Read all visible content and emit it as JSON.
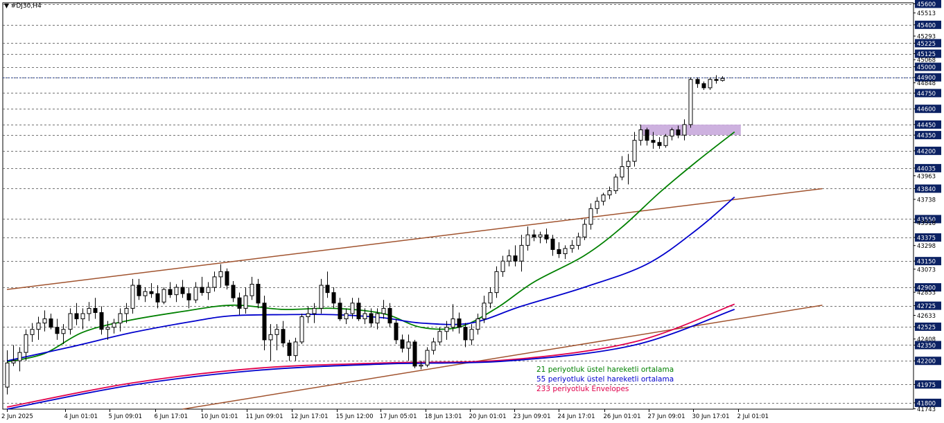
{
  "chart_data": {
    "type": "candlestick",
    "symbol_label": "#DJ30,H4",
    "title_marker": "▼",
    "ylim": [
      41740,
      45610
    ],
    "y_tick_labels": [
      45600,
      45513,
      45400,
      45293,
      45225,
      45125,
      45068,
      45000,
      44900,
      44848,
      44750,
      44600,
      44450,
      44350,
      44200,
      44035,
      43963,
      43840,
      43738,
      43550,
      43518,
      43375,
      43298,
      43150,
      43073,
      42900,
      42853,
      42725,
      42633,
      42525,
      42408,
      42350,
      42200,
      41975,
      41800,
      41743
    ],
    "highlighted_y_labels": [
      45600,
      45400,
      45225,
      45125,
      45000,
      44900,
      44750,
      44600,
      44450,
      44350,
      44200,
      44035,
      43840,
      43550,
      43375,
      43150,
      42900,
      42725,
      42525,
      42350,
      42200,
      41975,
      41800
    ],
    "horizontal_levels": [
      45600,
      45400,
      45225,
      45125,
      45000,
      44900,
      44750,
      44600,
      44450,
      44350,
      44200,
      44035,
      43840,
      43550,
      43375,
      43150,
      42900,
      42725,
      42525,
      42350,
      42200,
      41975,
      41800
    ],
    "current_price_level": 44900,
    "x_labels": [
      "2 Jun 2025",
      "4 Jun 01:01",
      "5 Jun 09:01",
      "6 Jun 17:01",
      "10 Jun 01:01",
      "11 Jun 09:01",
      "12 Jun 17:01",
      "15 Jun 12:00",
      "17 Jun 05:01",
      "18 Jun 13:01",
      "20 Jun 01:01",
      "23 Jun 09:01",
      "24 Jun 17:01",
      "26 Jun 01:01",
      "27 Jun 09:01",
      "30 Jun 17:01",
      "2 Jul 01:01"
    ],
    "candles": [
      {
        "o": 41950,
        "h": 42300,
        "l": 41880,
        "c": 42180
      },
      {
        "o": 42180,
        "h": 42350,
        "l": 42150,
        "c": 42200
      },
      {
        "o": 42200,
        "h": 42330,
        "l": 42100,
        "c": 42280
      },
      {
        "o": 42280,
        "h": 42500,
        "l": 42200,
        "c": 42450
      },
      {
        "o": 42450,
        "h": 42560,
        "l": 42380,
        "c": 42500
      },
      {
        "o": 42500,
        "h": 42620,
        "l": 42400,
        "c": 42560
      },
      {
        "o": 42560,
        "h": 42680,
        "l": 42480,
        "c": 42600
      },
      {
        "o": 42600,
        "h": 42650,
        "l": 42500,
        "c": 42520
      },
      {
        "o": 42520,
        "h": 42600,
        "l": 42400,
        "c": 42460
      },
      {
        "o": 42460,
        "h": 42550,
        "l": 42360,
        "c": 42500
      },
      {
        "o": 42500,
        "h": 42700,
        "l": 42450,
        "c": 42650
      },
      {
        "o": 42650,
        "h": 42750,
        "l": 42540,
        "c": 42600
      },
      {
        "o": 42600,
        "h": 42700,
        "l": 42500,
        "c": 42650
      },
      {
        "o": 42650,
        "h": 42760,
        "l": 42580,
        "c": 42700
      },
      {
        "o": 42700,
        "h": 42800,
        "l": 42600,
        "c": 42660
      },
      {
        "o": 42660,
        "h": 42720,
        "l": 42450,
        "c": 42500
      },
      {
        "o": 42500,
        "h": 42580,
        "l": 42400,
        "c": 42520
      },
      {
        "o": 42520,
        "h": 42600,
        "l": 42460,
        "c": 42560
      },
      {
        "o": 42560,
        "h": 42700,
        "l": 42480,
        "c": 42650
      },
      {
        "o": 42650,
        "h": 42750,
        "l": 42560,
        "c": 42700
      },
      {
        "o": 42700,
        "h": 42980,
        "l": 42650,
        "c": 42920
      },
      {
        "o": 42920,
        "h": 42980,
        "l": 42780,
        "c": 42820
      },
      {
        "o": 42820,
        "h": 42900,
        "l": 42760,
        "c": 42860
      },
      {
        "o": 42860,
        "h": 42940,
        "l": 42800,
        "c": 42840
      },
      {
        "o": 42840,
        "h": 42920,
        "l": 42700,
        "c": 42760
      },
      {
        "o": 42760,
        "h": 42900,
        "l": 42740,
        "c": 42880
      },
      {
        "o": 42880,
        "h": 42950,
        "l": 42800,
        "c": 42830
      },
      {
        "o": 42830,
        "h": 42930,
        "l": 42760,
        "c": 42900
      },
      {
        "o": 42900,
        "h": 42970,
        "l": 42800,
        "c": 42840
      },
      {
        "o": 42840,
        "h": 42900,
        "l": 42700,
        "c": 42780
      },
      {
        "o": 42780,
        "h": 42950,
        "l": 42750,
        "c": 42900
      },
      {
        "o": 42900,
        "h": 43000,
        "l": 42820,
        "c": 42850
      },
      {
        "o": 42850,
        "h": 42950,
        "l": 42780,
        "c": 42900
      },
      {
        "o": 42900,
        "h": 43050,
        "l": 42860,
        "c": 43000
      },
      {
        "o": 43000,
        "h": 43120,
        "l": 42900,
        "c": 43050
      },
      {
        "o": 43050,
        "h": 43080,
        "l": 42880,
        "c": 42920
      },
      {
        "o": 42920,
        "h": 42960,
        "l": 42760,
        "c": 42800
      },
      {
        "o": 42800,
        "h": 42850,
        "l": 42640,
        "c": 42700
      },
      {
        "o": 42700,
        "h": 42900,
        "l": 42650,
        "c": 42820
      },
      {
        "o": 42820,
        "h": 43000,
        "l": 42780,
        "c": 42930
      },
      {
        "o": 42930,
        "h": 42980,
        "l": 42700,
        "c": 42750
      },
      {
        "o": 42750,
        "h": 42820,
        "l": 42300,
        "c": 42400
      },
      {
        "o": 42400,
        "h": 42550,
        "l": 42200,
        "c": 42450
      },
      {
        "o": 42450,
        "h": 42550,
        "l": 42300,
        "c": 42500
      },
      {
        "o": 42500,
        "h": 42580,
        "l": 42330,
        "c": 42370
      },
      {
        "o": 42370,
        "h": 42400,
        "l": 42200,
        "c": 42250
      },
      {
        "o": 42250,
        "h": 42420,
        "l": 42200,
        "c": 42380
      },
      {
        "o": 42380,
        "h": 42650,
        "l": 42360,
        "c": 42620
      },
      {
        "o": 42620,
        "h": 42720,
        "l": 42560,
        "c": 42650
      },
      {
        "o": 42650,
        "h": 42750,
        "l": 42560,
        "c": 42700
      },
      {
        "o": 42700,
        "h": 42980,
        "l": 42650,
        "c": 42920
      },
      {
        "o": 42920,
        "h": 43050,
        "l": 42800,
        "c": 42850
      },
      {
        "o": 42850,
        "h": 42900,
        "l": 42700,
        "c": 42750
      },
      {
        "o": 42750,
        "h": 42800,
        "l": 42580,
        "c": 42600
      },
      {
        "o": 42600,
        "h": 42700,
        "l": 42550,
        "c": 42650
      },
      {
        "o": 42650,
        "h": 42800,
        "l": 42600,
        "c": 42750
      },
      {
        "o": 42750,
        "h": 42800,
        "l": 42580,
        "c": 42600
      },
      {
        "o": 42600,
        "h": 42700,
        "l": 42550,
        "c": 42650
      },
      {
        "o": 42650,
        "h": 42700,
        "l": 42520,
        "c": 42560
      },
      {
        "o": 42560,
        "h": 42700,
        "l": 42500,
        "c": 42650
      },
      {
        "o": 42650,
        "h": 42780,
        "l": 42600,
        "c": 42700
      },
      {
        "o": 42700,
        "h": 42750,
        "l": 42520,
        "c": 42560
      },
      {
        "o": 42560,
        "h": 42600,
        "l": 42360,
        "c": 42400
      },
      {
        "o": 42400,
        "h": 42450,
        "l": 42280,
        "c": 42320
      },
      {
        "o": 42320,
        "h": 42450,
        "l": 42200,
        "c": 42380
      },
      {
        "o": 42380,
        "h": 42400,
        "l": 42130,
        "c": 42150
      },
      {
        "o": 42150,
        "h": 42200,
        "l": 42120,
        "c": 42160
      },
      {
        "o": 42160,
        "h": 42330,
        "l": 42140,
        "c": 42300
      },
      {
        "o": 42300,
        "h": 42420,
        "l": 42260,
        "c": 42380
      },
      {
        "o": 42380,
        "h": 42520,
        "l": 42350,
        "c": 42480
      },
      {
        "o": 42480,
        "h": 42580,
        "l": 42400,
        "c": 42520
      },
      {
        "o": 42520,
        "h": 42740,
        "l": 42480,
        "c": 42600
      },
      {
        "o": 42600,
        "h": 42660,
        "l": 42460,
        "c": 42520
      },
      {
        "o": 42520,
        "h": 42560,
        "l": 42330,
        "c": 42400
      },
      {
        "o": 42400,
        "h": 42550,
        "l": 42350,
        "c": 42500
      },
      {
        "o": 42500,
        "h": 42650,
        "l": 42450,
        "c": 42600
      },
      {
        "o": 42600,
        "h": 42820,
        "l": 42560,
        "c": 42750
      },
      {
        "o": 42750,
        "h": 42900,
        "l": 42700,
        "c": 42850
      },
      {
        "o": 42850,
        "h": 43100,
        "l": 42800,
        "c": 43050
      },
      {
        "o": 43050,
        "h": 43200,
        "l": 43000,
        "c": 43150
      },
      {
        "o": 43150,
        "h": 43260,
        "l": 43100,
        "c": 43200
      },
      {
        "o": 43200,
        "h": 43300,
        "l": 43100,
        "c": 43150
      },
      {
        "o": 43150,
        "h": 43400,
        "l": 43050,
        "c": 43300
      },
      {
        "o": 43300,
        "h": 43480,
        "l": 43250,
        "c": 43400
      },
      {
        "o": 43400,
        "h": 43450,
        "l": 43340,
        "c": 43380
      },
      {
        "o": 43380,
        "h": 43430,
        "l": 43320,
        "c": 43400
      },
      {
        "o": 43400,
        "h": 43460,
        "l": 43320,
        "c": 43360
      },
      {
        "o": 43360,
        "h": 43400,
        "l": 43200,
        "c": 43260
      },
      {
        "o": 43260,
        "h": 43330,
        "l": 43180,
        "c": 43220
      },
      {
        "o": 43220,
        "h": 43300,
        "l": 43170,
        "c": 43270
      },
      {
        "o": 43270,
        "h": 43350,
        "l": 43230,
        "c": 43300
      },
      {
        "o": 43300,
        "h": 43420,
        "l": 43260,
        "c": 43380
      },
      {
        "o": 43380,
        "h": 43550,
        "l": 43350,
        "c": 43500
      },
      {
        "o": 43500,
        "h": 43700,
        "l": 43450,
        "c": 43650
      },
      {
        "o": 43650,
        "h": 43760,
        "l": 43600,
        "c": 43720
      },
      {
        "o": 43720,
        "h": 43800,
        "l": 43680,
        "c": 43780
      },
      {
        "o": 43780,
        "h": 43860,
        "l": 43740,
        "c": 43820
      },
      {
        "o": 43820,
        "h": 43980,
        "l": 43790,
        "c": 43950
      },
      {
        "o": 43950,
        "h": 44150,
        "l": 43920,
        "c": 44050
      },
      {
        "o": 44050,
        "h": 44170,
        "l": 43880,
        "c": 44100
      },
      {
        "o": 44100,
        "h": 44380,
        "l": 44050,
        "c": 44300
      },
      {
        "o": 44300,
        "h": 44450,
        "l": 44250,
        "c": 44400
      },
      {
        "o": 44400,
        "h": 44420,
        "l": 44250,
        "c": 44300
      },
      {
        "o": 44300,
        "h": 44380,
        "l": 44220,
        "c": 44280
      },
      {
        "o": 44280,
        "h": 44330,
        "l": 44220,
        "c": 44250
      },
      {
        "o": 44250,
        "h": 44360,
        "l": 44230,
        "c": 44340
      },
      {
        "o": 44340,
        "h": 44420,
        "l": 44300,
        "c": 44400
      },
      {
        "o": 44400,
        "h": 44440,
        "l": 44320,
        "c": 44350
      },
      {
        "o": 44350,
        "h": 44500,
        "l": 44300,
        "c": 44450
      },
      {
        "o": 44450,
        "h": 44900,
        "l": 44420,
        "c": 44880
      },
      {
        "o": 44880,
        "h": 44900,
        "l": 44800,
        "c": 44840
      },
      {
        "o": 44840,
        "h": 44860,
        "l": 44780,
        "c": 44800
      },
      {
        "o": 44800,
        "h": 44900,
        "l": 44780,
        "c": 44880
      },
      {
        "o": 44880,
        "h": 44920,
        "l": 44840,
        "c": 44870
      },
      {
        "o": 44870,
        "h": 44910,
        "l": 44860,
        "c": 44890
      }
    ],
    "series": [
      {
        "name": "21 periyotluk üstel hareketli ortalama",
        "color": "#008000",
        "points": [
          [
            0,
            42190
          ],
          [
            6,
            42270
          ],
          [
            12,
            42470
          ],
          [
            19,
            42580
          ],
          [
            28,
            42670
          ],
          [
            36,
            42730
          ],
          [
            44,
            42690
          ],
          [
            52,
            42700
          ],
          [
            60,
            42650
          ],
          [
            66,
            42520
          ],
          [
            72,
            42520
          ],
          [
            78,
            42700
          ],
          [
            84,
            42950
          ],
          [
            92,
            43200
          ],
          [
            98,
            43470
          ],
          [
            104,
            43800
          ],
          [
            110,
            44100
          ],
          [
            116,
            44380
          ]
        ]
      },
      {
        "name": "55 periyotluk üstel hareketli ortalama",
        "color": "#0000cc",
        "points": [
          [
            0,
            42200
          ],
          [
            10,
            42330
          ],
          [
            20,
            42470
          ],
          [
            30,
            42580
          ],
          [
            36,
            42630
          ],
          [
            44,
            42640
          ],
          [
            52,
            42640
          ],
          [
            60,
            42610
          ],
          [
            66,
            42560
          ],
          [
            74,
            42560
          ],
          [
            82,
            42720
          ],
          [
            92,
            42900
          ],
          [
            102,
            43120
          ],
          [
            110,
            43450
          ],
          [
            116,
            43760
          ]
        ]
      },
      {
        "name": "233 periyotluk Envelopes",
        "color": "#e0004b",
        "points": [
          [
            0,
            41760
          ],
          [
            20,
            41990
          ],
          [
            40,
            42130
          ],
          [
            60,
            42180
          ],
          [
            80,
            42210
          ],
          [
            100,
            42380
          ],
          [
            116,
            42740
          ]
        ]
      },
      {
        "color": "#0000cc",
        "points": [
          [
            0,
            41740
          ],
          [
            20,
            41970
          ],
          [
            40,
            42110
          ],
          [
            60,
            42170
          ],
          [
            80,
            42200
          ],
          [
            100,
            42350
          ],
          [
            116,
            42690
          ]
        ]
      }
    ],
    "channel_lines": [
      {
        "color": "#a0522d",
        "points": [
          [
            0,
            42880
          ],
          [
            130,
            43840
          ]
        ]
      },
      {
        "color": "#a0522d",
        "points": [
          [
            28,
            41740
          ],
          [
            130,
            42730
          ]
        ]
      }
    ],
    "zone": {
      "from_index": 101,
      "to_index": 117,
      "low": 44350,
      "high": 44450,
      "color": "#c8a8dc"
    },
    "legend": [
      {
        "text": "21 periyotluk üstel hareketli ortalama",
        "color": "#008000"
      },
      {
        "text": "55 periyotluk üstel hareketli ortalama",
        "color": "#0000cc"
      },
      {
        "text": "233 periyotluk Envelopes",
        "color": "#e0004b"
      }
    ]
  }
}
